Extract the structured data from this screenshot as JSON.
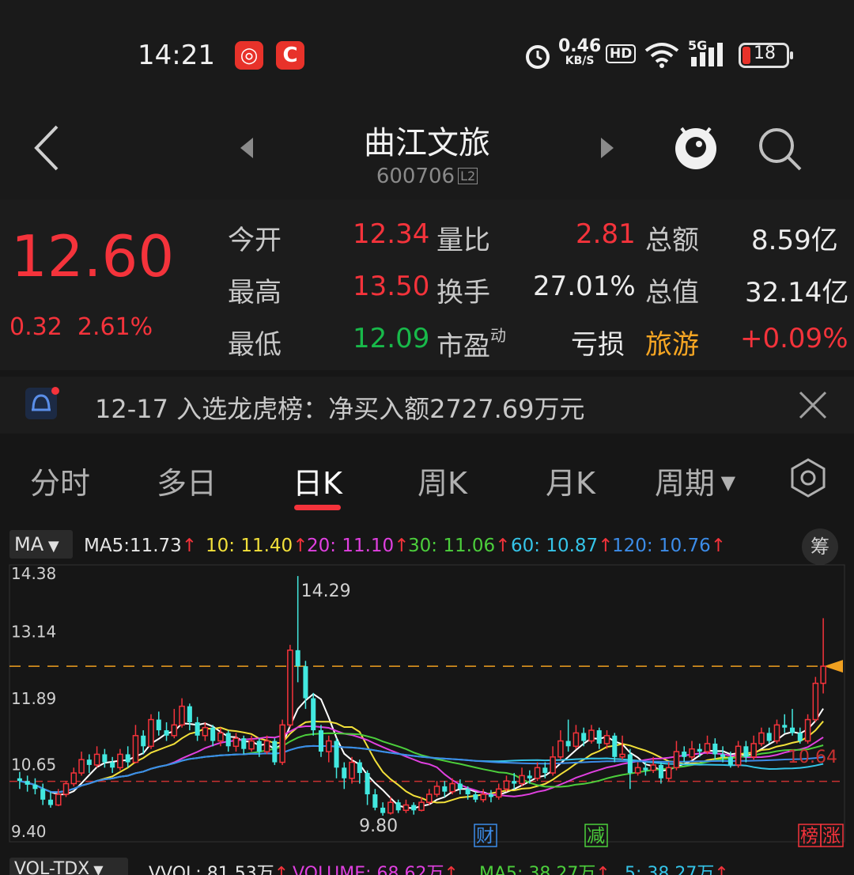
{
  "status": {
    "time": "14:21",
    "net_speed": "0.46",
    "net_unit": "KB/S",
    "hd": "HD",
    "signal": "5G",
    "battery": "18"
  },
  "header": {
    "title": "曲江文旅",
    "code": "600706",
    "level": "L2"
  },
  "quote": {
    "price": "12.60",
    "change": "0.32",
    "change_pct": "2.61%",
    "rows": [
      {
        "l1": "今开",
        "v1": "12.34",
        "l2": "量比",
        "v2": "2.81",
        "l3": "总额",
        "v3": "8.59亿"
      },
      {
        "l1": "最高",
        "v1": "13.50",
        "l2": "换手",
        "v2": "27.01%",
        "l3": "总值",
        "v3": "32.14亿"
      },
      {
        "l1": "最低",
        "v1": "12.09",
        "l2": "市盈",
        "l2_sup": "动",
        "v2": "亏损",
        "l3": "旅游",
        "v3": "+0.09%"
      }
    ]
  },
  "notice": {
    "text": "12-17 入选龙虎榜：净买入额2727.69万元"
  },
  "tabs": [
    "分时",
    "多日",
    "日K",
    "周K",
    "月K",
    "周期"
  ],
  "ma": {
    "selector": "MA",
    "items": [
      {
        "label": "MA5:",
        "value": "11.73",
        "color": "#e6e6e6"
      },
      {
        "label": "10:",
        "value": "11.40",
        "color": "#f2e03a"
      },
      {
        "label": "20:",
        "value": "11.10",
        "color": "#e040e0"
      },
      {
        "label": "30:",
        "value": "11.06",
        "color": "#4ccf3c"
      },
      {
        "label": "60:",
        "value": "10.87",
        "color": "#35c4e8"
      },
      {
        "label": "120:",
        "value": "10.76",
        "color": "#3c8ce8"
      }
    ],
    "chip_button": "筹"
  },
  "chart_data": {
    "type": "candlestick",
    "y_ticks": [
      "14.38",
      "13.14",
      "11.89",
      "10.65",
      "9.40"
    ],
    "ylim": [
      9.4,
      14.38
    ],
    "high_label": "14.29",
    "low_label": "9.80",
    "ma120_end_label": "10.64",
    "current_price_line": 12.6,
    "markers": [
      "财",
      "减",
      "榜",
      "涨"
    ],
    "candles": [
      [
        10.5,
        10.45,
        10.62,
        10.3
      ],
      [
        10.45,
        10.38,
        10.55,
        10.25
      ],
      [
        10.38,
        10.3,
        10.5,
        10.2
      ],
      [
        10.3,
        10.1,
        10.4,
        10.0
      ],
      [
        10.1,
        10.0,
        10.25,
        9.95
      ],
      [
        10.0,
        10.2,
        10.3,
        9.98
      ],
      [
        10.2,
        10.4,
        10.45,
        10.15
      ],
      [
        10.4,
        10.6,
        10.7,
        10.35
      ],
      [
        10.6,
        10.85,
        11.0,
        10.55
      ],
      [
        10.85,
        10.75,
        10.95,
        10.6
      ],
      [
        10.75,
        10.95,
        11.1,
        10.7
      ],
      [
        10.95,
        10.8,
        11.05,
        10.7
      ],
      [
        10.8,
        10.7,
        10.9,
        10.6
      ],
      [
        10.7,
        10.95,
        11.05,
        10.65
      ],
      [
        10.95,
        10.8,
        11.1,
        10.7
      ],
      [
        10.8,
        11.3,
        11.5,
        10.78
      ],
      [
        11.3,
        11.1,
        11.4,
        10.95
      ],
      [
        11.1,
        11.6,
        11.7,
        11.05
      ],
      [
        11.6,
        11.4,
        11.75,
        11.3
      ],
      [
        11.4,
        11.3,
        11.55,
        11.2
      ],
      [
        11.3,
        11.5,
        11.8,
        11.25
      ],
      [
        11.5,
        11.85,
        12.0,
        11.45
      ],
      [
        11.85,
        11.55,
        11.9,
        11.4
      ],
      [
        11.55,
        11.3,
        11.65,
        11.2
      ],
      [
        11.3,
        11.45,
        11.55,
        11.2
      ],
      [
        11.45,
        11.2,
        11.5,
        11.1
      ],
      [
        11.2,
        11.35,
        11.45,
        11.1
      ],
      [
        11.35,
        11.1,
        11.4,
        11.0
      ],
      [
        11.1,
        11.25,
        11.35,
        11.0
      ],
      [
        11.25,
        11.05,
        11.3,
        10.95
      ],
      [
        11.05,
        11.2,
        11.3,
        11.0
      ],
      [
        11.2,
        11.0,
        11.25,
        10.9
      ],
      [
        11.0,
        11.2,
        11.3,
        10.95
      ],
      [
        11.2,
        10.8,
        11.25,
        10.75
      ],
      [
        10.8,
        11.5,
        11.6,
        10.75
      ],
      [
        11.5,
        12.9,
        13.0,
        11.45
      ],
      [
        12.9,
        12.6,
        14.29,
        12.3
      ],
      [
        12.6,
        12.0,
        12.7,
        11.8
      ],
      [
        12.0,
        11.4,
        12.1,
        11.3
      ],
      [
        11.4,
        11.0,
        11.5,
        10.9
      ],
      [
        11.0,
        11.2,
        11.3,
        10.8
      ],
      [
        11.2,
        10.7,
        11.25,
        10.5
      ],
      [
        10.7,
        10.5,
        10.8,
        10.3
      ],
      [
        10.5,
        10.8,
        10.9,
        10.4
      ],
      [
        10.8,
        10.6,
        10.85,
        10.4
      ],
      [
        10.6,
        10.2,
        10.65,
        10.0
      ],
      [
        10.2,
        9.95,
        10.3,
        9.9
      ],
      [
        9.95,
        9.85,
        10.05,
        9.8
      ],
      [
        9.85,
        10.05,
        10.15,
        9.82
      ],
      [
        10.05,
        9.9,
        10.1,
        9.85
      ],
      [
        9.9,
        10.0,
        10.1,
        9.85
      ],
      [
        10.0,
        9.9,
        10.05,
        9.82
      ],
      [
        9.9,
        10.05,
        10.15,
        9.88
      ],
      [
        10.05,
        10.2,
        10.3,
        10.0
      ],
      [
        10.2,
        10.35,
        10.45,
        10.15
      ],
      [
        10.35,
        10.25,
        10.45,
        10.15
      ],
      [
        10.25,
        10.4,
        10.5,
        10.2
      ],
      [
        10.4,
        10.3,
        10.48,
        10.2
      ],
      [
        10.3,
        10.2,
        10.35,
        10.1
      ],
      [
        10.2,
        10.1,
        10.25,
        10.05
      ],
      [
        10.1,
        10.2,
        10.3,
        10.05
      ],
      [
        10.2,
        10.15,
        10.28,
        10.05
      ],
      [
        10.15,
        10.3,
        10.4,
        10.1
      ],
      [
        10.3,
        10.45,
        10.55,
        10.25
      ],
      [
        10.45,
        10.4,
        10.6,
        10.3
      ],
      [
        10.4,
        10.55,
        10.7,
        10.35
      ],
      [
        10.55,
        10.5,
        10.65,
        10.4
      ],
      [
        10.5,
        10.7,
        10.8,
        10.45
      ],
      [
        10.7,
        10.6,
        10.8,
        10.5
      ],
      [
        10.6,
        10.9,
        11.1,
        10.55
      ],
      [
        10.9,
        11.2,
        11.4,
        10.85
      ],
      [
        11.2,
        11.1,
        11.6,
        11.0
      ],
      [
        11.1,
        11.35,
        11.5,
        11.05
      ],
      [
        11.35,
        11.2,
        11.45,
        11.1
      ],
      [
        11.2,
        11.4,
        11.5,
        11.15
      ],
      [
        11.4,
        11.15,
        11.45,
        11.05
      ],
      [
        11.15,
        11.3,
        11.4,
        11.05
      ],
      [
        11.3,
        10.9,
        11.35,
        10.8
      ],
      [
        10.9,
        10.95,
        11.3,
        10.85
      ],
      [
        10.95,
        10.6,
        11.05,
        10.3
      ],
      [
        10.6,
        10.7,
        10.8,
        10.55
      ],
      [
        10.7,
        10.65,
        10.8,
        10.55
      ],
      [
        10.65,
        10.75,
        10.9,
        10.6
      ],
      [
        10.75,
        10.5,
        10.8,
        10.4
      ],
      [
        10.5,
        10.7,
        10.8,
        10.45
      ],
      [
        10.7,
        11.0,
        11.2,
        10.65
      ],
      [
        11.0,
        10.9,
        11.1,
        10.8
      ],
      [
        10.9,
        11.05,
        11.2,
        10.85
      ],
      [
        11.05,
        11.0,
        11.15,
        10.9
      ],
      [
        11.0,
        11.15,
        11.3,
        10.95
      ],
      [
        11.15,
        10.95,
        11.25,
        10.85
      ],
      [
        10.95,
        10.9,
        11.1,
        10.8
      ],
      [
        10.9,
        10.75,
        11.0,
        10.7
      ],
      [
        10.75,
        11.1,
        11.2,
        10.7
      ],
      [
        11.1,
        10.9,
        11.2,
        10.8
      ],
      [
        10.9,
        11.15,
        11.3,
        10.85
      ],
      [
        11.15,
        11.35,
        11.45,
        11.1
      ],
      [
        11.35,
        11.2,
        11.45,
        11.15
      ],
      [
        11.2,
        11.5,
        11.6,
        11.15
      ],
      [
        11.5,
        11.45,
        11.7,
        11.35
      ],
      [
        11.45,
        11.35,
        11.8,
        11.3
      ],
      [
        11.35,
        11.2,
        11.45,
        11.15
      ],
      [
        11.2,
        11.6,
        11.7,
        11.15
      ],
      [
        11.6,
        12.28,
        12.4,
        11.55
      ],
      [
        12.28,
        12.6,
        13.5,
        12.09
      ]
    ],
    "ma_colors": {
      "ma5": "#ffffff",
      "ma10": "#f2e03a",
      "ma20": "#e040e0",
      "ma30": "#4ccf3c",
      "ma60": "#35c4e8",
      "ma120": "#3c8ce8"
    },
    "up_color": "#f4333b",
    "down_color": "#42e8e0",
    "price_line_color": "#f0a020"
  },
  "volume": {
    "selector": "VOL-TDX",
    "items": [
      {
        "label": "VVOL: ",
        "value": "81.53万",
        "color": "#e6e6e6"
      },
      {
        "label": "VOLUME: ",
        "value": "68.62万",
        "color": "#e040e0"
      },
      {
        "label": "MA5: ",
        "value": "38.27万",
        "color": "#4ccf3c"
      },
      {
        "label": "5: ",
        "value": "38.27万",
        "color": "#35c4e8"
      }
    ]
  }
}
